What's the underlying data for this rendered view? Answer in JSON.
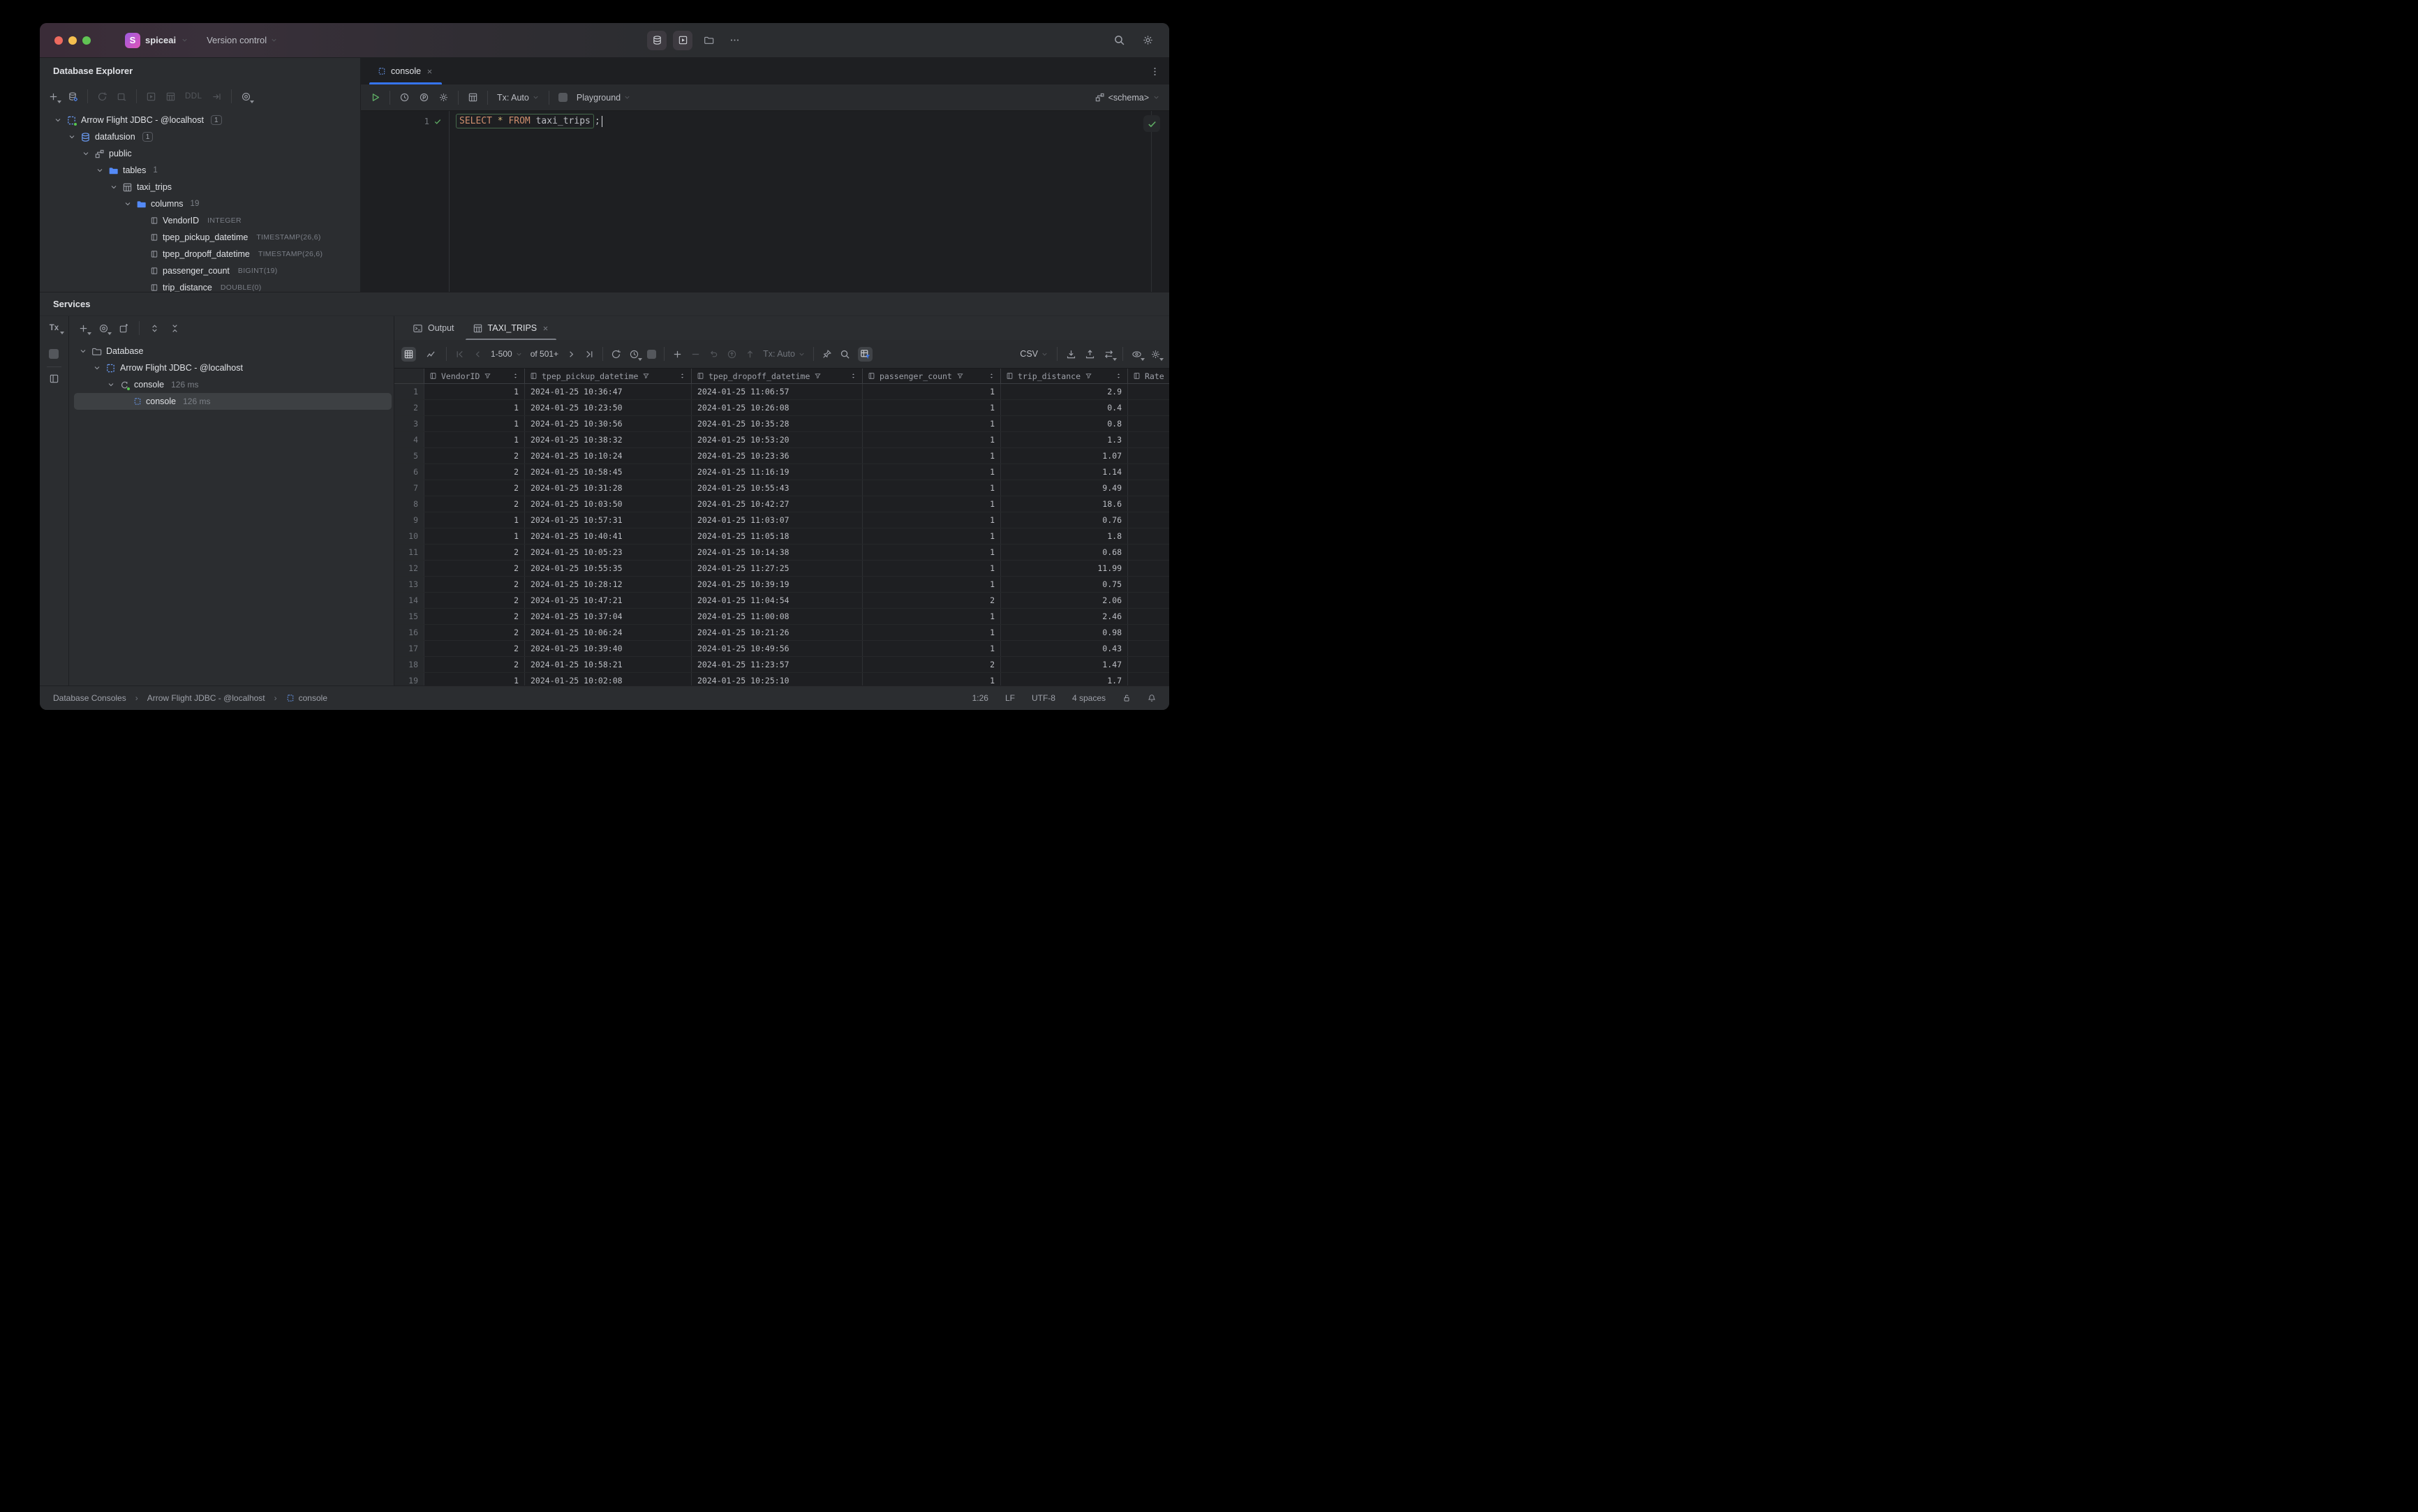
{
  "title_bar": {
    "project_initial": "S",
    "project_name": "spiceai",
    "vcs_label": "Version control",
    "right_icons": [
      "database-icon",
      "run-icon",
      "folder-icon",
      "more-icon",
      "search-icon",
      "settings-icon"
    ]
  },
  "explorer": {
    "title": "Database Explorer",
    "toolbar_icons": [
      "add",
      "data-source-properties",
      "refresh",
      "disconnect",
      "jump-to-console",
      "open-table",
      "ddl",
      "jump-to-source",
      "view-options"
    ],
    "ddl_label": "DDL",
    "tree": [
      {
        "label": "Arrow Flight JDBC - @localhost",
        "badge": "1"
      },
      {
        "label": "datafusion",
        "badge": "1"
      },
      {
        "label": "public"
      },
      {
        "label": "tables",
        "count": "1"
      },
      {
        "label": "taxi_trips"
      },
      {
        "label": "columns",
        "count": "19"
      },
      {
        "label": "VendorID",
        "type": "INTEGER"
      },
      {
        "label": "tpep_pickup_datetime",
        "type": "TIMESTAMP(26,6)"
      },
      {
        "label": "tpep_dropoff_datetime",
        "type": "TIMESTAMP(26,6)"
      },
      {
        "label": "passenger_count",
        "type": "BIGINT(19)"
      },
      {
        "label": "trip_distance",
        "type": "DOUBLE(0)"
      }
    ]
  },
  "editor": {
    "tab_label": "console",
    "toolbar": {
      "tx_label": "Tx: Auto",
      "playground_label": "Playground",
      "schema_label": "<schema>"
    },
    "gutter_line": "1",
    "sql": {
      "statement_tokens": [
        {
          "text": "SELECT",
          "style": "keyword"
        },
        {
          "text": " ",
          "style": "plain"
        },
        {
          "text": "*",
          "style": "star"
        },
        {
          "text": " ",
          "style": "plain"
        },
        {
          "text": "FROM",
          "style": "keyword"
        },
        {
          "text": " ",
          "style": "plain"
        },
        {
          "text": "taxi_trips",
          "style": "plain"
        }
      ],
      "trailing": ";"
    }
  },
  "services": {
    "title": "Services",
    "tx_badge": "Tx",
    "tree": [
      {
        "label": "Database"
      },
      {
        "label": "Arrow Flight JDBC - @localhost"
      },
      {
        "label": "console",
        "time": "126 ms"
      },
      {
        "label": "console",
        "time": "126 ms"
      }
    ]
  },
  "results": {
    "tabs": [
      {
        "label": "Output"
      },
      {
        "label": "TAXI_TRIPS"
      }
    ],
    "toolbar": {
      "page_range": "1-500",
      "page_total": "of 501+",
      "tx_label": "Tx: Auto",
      "format_label": "CSV"
    },
    "grid": {
      "columns": [
        {
          "label": "VendorID"
        },
        {
          "label": "tpep_pickup_datetime"
        },
        {
          "label": "tpep_dropoff_datetime"
        },
        {
          "label": "passenger_count"
        },
        {
          "label": "trip_distance"
        },
        {
          "label": "Rate"
        }
      ],
      "rows": [
        {
          "n": "1",
          "vendor": "1",
          "pickup": "2024-01-25 10:36:47",
          "dropoff": "2024-01-25 11:06:57",
          "passengers": "1",
          "distance": "2.9"
        },
        {
          "n": "2",
          "vendor": "1",
          "pickup": "2024-01-25 10:23:50",
          "dropoff": "2024-01-25 10:26:08",
          "passengers": "1",
          "distance": "0.4"
        },
        {
          "n": "3",
          "vendor": "1",
          "pickup": "2024-01-25 10:30:56",
          "dropoff": "2024-01-25 10:35:28",
          "passengers": "1",
          "distance": "0.8"
        },
        {
          "n": "4",
          "vendor": "1",
          "pickup": "2024-01-25 10:38:32",
          "dropoff": "2024-01-25 10:53:20",
          "passengers": "1",
          "distance": "1.3"
        },
        {
          "n": "5",
          "vendor": "2",
          "pickup": "2024-01-25 10:10:24",
          "dropoff": "2024-01-25 10:23:36",
          "passengers": "1",
          "distance": "1.07"
        },
        {
          "n": "6",
          "vendor": "2",
          "pickup": "2024-01-25 10:58:45",
          "dropoff": "2024-01-25 11:16:19",
          "passengers": "1",
          "distance": "1.14"
        },
        {
          "n": "7",
          "vendor": "2",
          "pickup": "2024-01-25 10:31:28",
          "dropoff": "2024-01-25 10:55:43",
          "passengers": "1",
          "distance": "9.49"
        },
        {
          "n": "8",
          "vendor": "2",
          "pickup": "2024-01-25 10:03:50",
          "dropoff": "2024-01-25 10:42:27",
          "passengers": "1",
          "distance": "18.6"
        },
        {
          "n": "9",
          "vendor": "1",
          "pickup": "2024-01-25 10:57:31",
          "dropoff": "2024-01-25 11:03:07",
          "passengers": "1",
          "distance": "0.76"
        },
        {
          "n": "10",
          "vendor": "1",
          "pickup": "2024-01-25 10:40:41",
          "dropoff": "2024-01-25 11:05:18",
          "passengers": "1",
          "distance": "1.8"
        },
        {
          "n": "11",
          "vendor": "2",
          "pickup": "2024-01-25 10:05:23",
          "dropoff": "2024-01-25 10:14:38",
          "passengers": "1",
          "distance": "0.68"
        },
        {
          "n": "12",
          "vendor": "2",
          "pickup": "2024-01-25 10:55:35",
          "dropoff": "2024-01-25 11:27:25",
          "passengers": "1",
          "distance": "11.99"
        },
        {
          "n": "13",
          "vendor": "2",
          "pickup": "2024-01-25 10:28:12",
          "dropoff": "2024-01-25 10:39:19",
          "passengers": "1",
          "distance": "0.75"
        },
        {
          "n": "14",
          "vendor": "2",
          "pickup": "2024-01-25 10:47:21",
          "dropoff": "2024-01-25 11:04:54",
          "passengers": "2",
          "distance": "2.06"
        },
        {
          "n": "15",
          "vendor": "2",
          "pickup": "2024-01-25 10:37:04",
          "dropoff": "2024-01-25 11:00:08",
          "passengers": "1",
          "distance": "2.46"
        },
        {
          "n": "16",
          "vendor": "2",
          "pickup": "2024-01-25 10:06:24",
          "dropoff": "2024-01-25 10:21:26",
          "passengers": "1",
          "distance": "0.98"
        },
        {
          "n": "17",
          "vendor": "2",
          "pickup": "2024-01-25 10:39:40",
          "dropoff": "2024-01-25 10:49:56",
          "passengers": "1",
          "distance": "0.43"
        },
        {
          "n": "18",
          "vendor": "2",
          "pickup": "2024-01-25 10:58:21",
          "dropoff": "2024-01-25 11:23:57",
          "passengers": "2",
          "distance": "1.47"
        },
        {
          "n": "19",
          "vendor": "1",
          "pickup": "2024-01-25 10:02:08",
          "dropoff": "2024-01-25 10:25:10",
          "passengers": "1",
          "distance": "1.7"
        }
      ]
    }
  },
  "status_bar": {
    "breadcrumbs": [
      "Database Consoles",
      "Arrow Flight JDBC - @localhost",
      "console"
    ],
    "caret_position": "1:26",
    "line_ending": "LF",
    "encoding": "UTF-8",
    "indent": "4 spaces"
  },
  "colors": {
    "accent_blue": "#3574f0",
    "folder_blue": "#548af7",
    "status_green": "#5fad65",
    "keyword_orange": "#cf8e6d",
    "asterisk_yellow": "#d5b778"
  }
}
